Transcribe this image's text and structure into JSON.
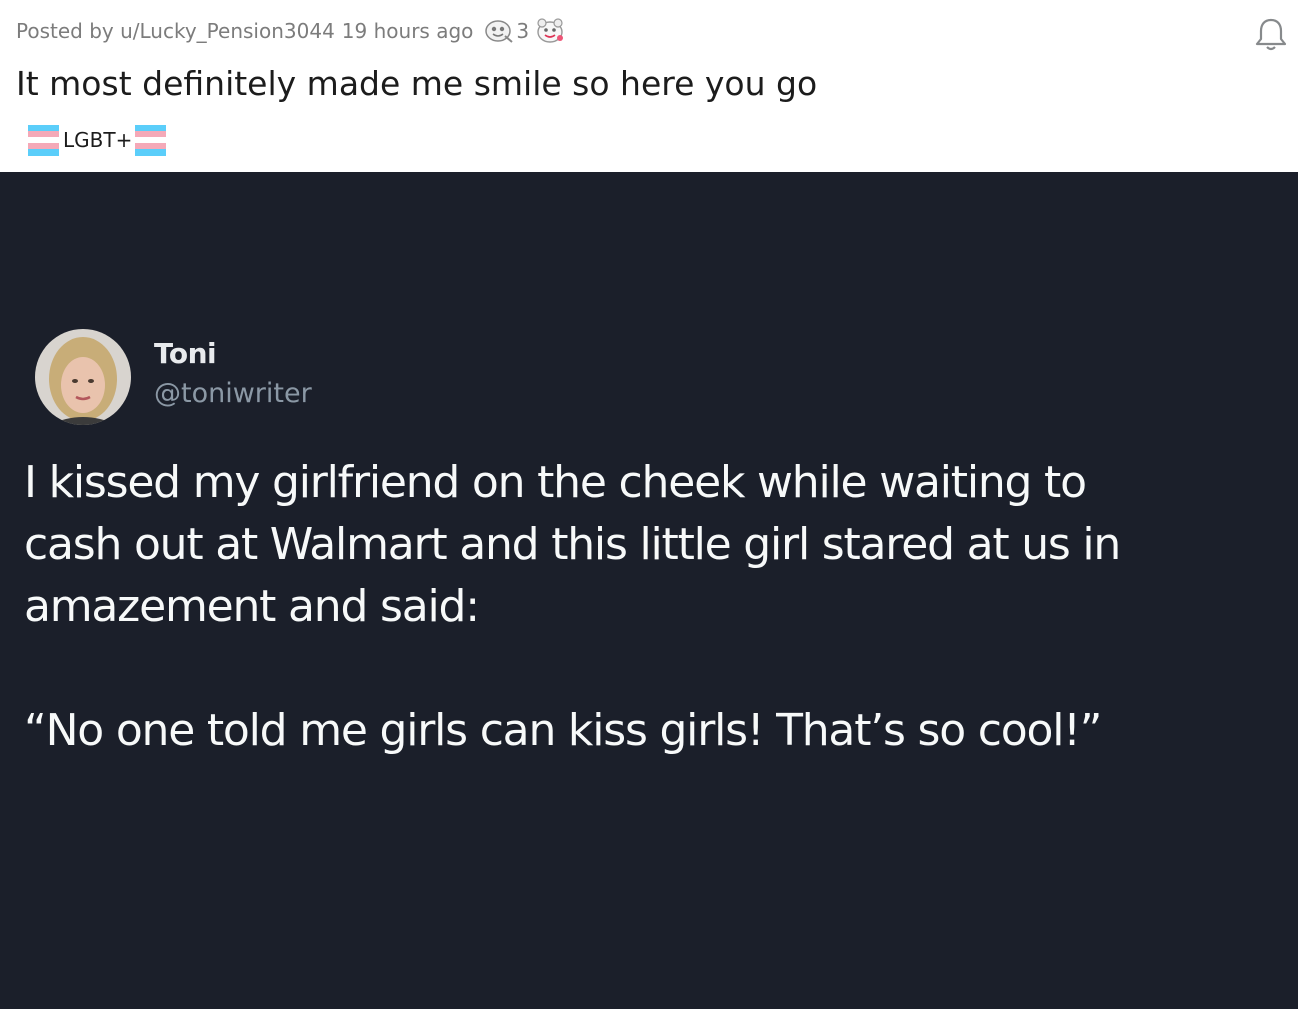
{
  "post": {
    "author_line": "Posted by u/Lucky_Pension3044",
    "time_ago": "19 hours ago",
    "award_count": "3",
    "title": "It most definitely made me smile so here you go",
    "flair": "LGBT+",
    "icons": {
      "award": "award-badge-icon",
      "award_second": "wholesome-award-icon",
      "notification": "bell-icon",
      "flair_flag": "transgender-flag-icon"
    },
    "colors": {
      "flag_blue": "#5bcefa",
      "flag_pink": "#f5a9b8",
      "tweet_background": "#1b1f2a"
    }
  },
  "tweet": {
    "name": "Toni",
    "handle": "@toniwriter",
    "text_lines": [
      "I kissed my girlfriend on the cheek while waiting to",
      "cash out at Walmart and this little girl stared at us in",
      "amazement and said:"
    ],
    "quote": "“No one told me girls can kiss girls! That’s so cool!”"
  }
}
